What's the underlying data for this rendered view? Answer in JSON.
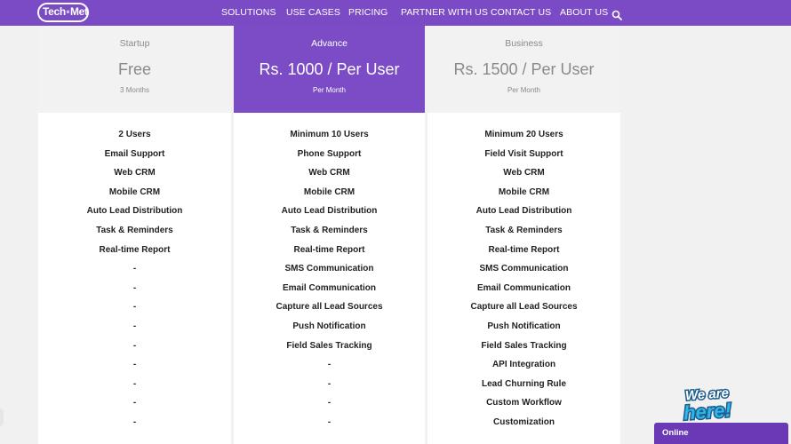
{
  "logo": {
    "text_a": "Tech",
    "text_b": "Met",
    "text_mid": "e"
  },
  "nav": {
    "items": [
      {
        "label": "SOLUTIONS",
        "key": "solutions"
      },
      {
        "label": "USE CASES",
        "key": "use-cases"
      },
      {
        "label": "PRICING",
        "key": "pricing"
      },
      {
        "label": "PARTNER WITH US",
        "key": "partner"
      },
      {
        "label": "CONTACT US",
        "key": "contact"
      },
      {
        "label": "ABOUT US",
        "key": "about"
      }
    ],
    "search_icon": "search-icon"
  },
  "plans": [
    {
      "tier": "Startup",
      "price": "Free",
      "period": "3 Months",
      "features": [
        "2 Users",
        "Email Support",
        "Web CRM",
        "Mobile CRM",
        "Auto Lead Distribution",
        "Task & Reminders",
        "Real-time Report",
        "-",
        "-",
        "-",
        "-",
        "-",
        "-",
        "-",
        "-",
        "-"
      ]
    },
    {
      "tier": "Advance",
      "price": "Rs. 1000 / Per User",
      "period": "Per Month",
      "features": [
        "Minimum 10 Users",
        "Phone Support",
        "Web CRM",
        "Mobile CRM",
        "Auto Lead Distribution",
        "Task & Reminders",
        "Real-time Report",
        "SMS Communication",
        "Email Communication",
        "Capture all Lead Sources",
        "Push Notification",
        "Field Sales Tracking",
        "-",
        "-",
        "-",
        "-"
      ]
    },
    {
      "tier": "Business",
      "price": "Rs. 1500 / Per User",
      "period": "Per Month",
      "features": [
        "Minimum 20 Users",
        "Field Visit Support",
        "Web CRM",
        "Mobile CRM",
        "Auto Lead Distribution",
        "Task & Reminders",
        "Real-time Report",
        "SMS Communication",
        "Email Communication",
        "Capture all Lead Sources",
        "Push Notification",
        "Field Sales Tracking",
        "API Integration",
        "Lead Churning Rule",
        "Custom Workflow",
        "Customization"
      ]
    }
  ],
  "chat": {
    "badge_text": "We are here!",
    "status": "Online"
  },
  "colors": {
    "brand": "#7a4bc5",
    "header_gray": "#f2f2f2",
    "chat": "#6b39b6"
  }
}
